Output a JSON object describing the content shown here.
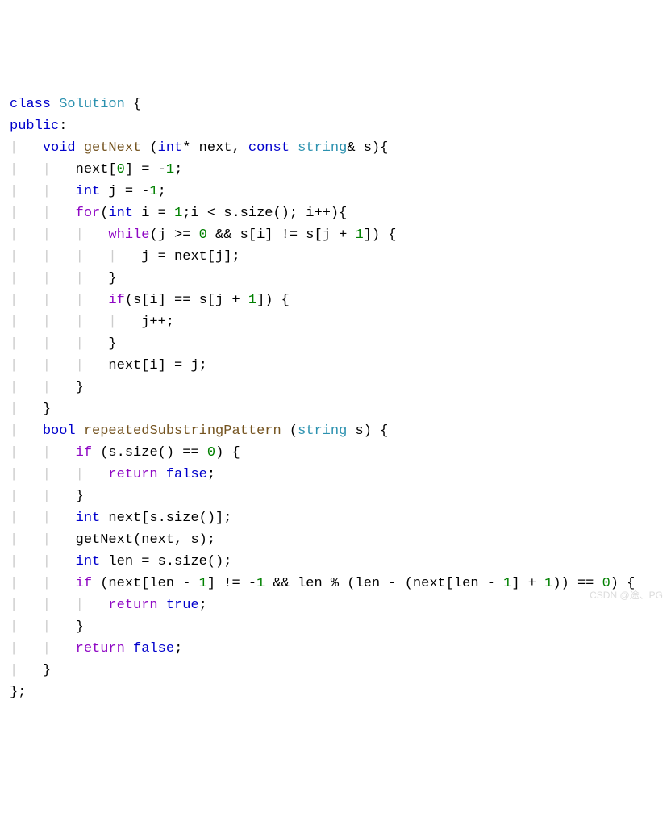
{
  "code": {
    "lines": [
      [
        {
          "cls": "kw",
          "t": "class"
        },
        {
          "cls": "txt",
          "t": " "
        },
        {
          "cls": "classname",
          "t": "Solution"
        },
        {
          "cls": "txt",
          "t": " {"
        }
      ],
      [
        {
          "cls": "kw",
          "t": "public"
        },
        {
          "cls": "txt",
          "t": ":"
        }
      ],
      [
        {
          "cls": "guide",
          "t": "|   "
        },
        {
          "cls": "kw",
          "t": "void"
        },
        {
          "cls": "txt",
          "t": " "
        },
        {
          "cls": "method",
          "t": "getNext"
        },
        {
          "cls": "txt",
          "t": " ("
        },
        {
          "cls": "kw",
          "t": "int"
        },
        {
          "cls": "txt",
          "t": "* next, "
        },
        {
          "cls": "kw",
          "t": "const"
        },
        {
          "cls": "txt",
          "t": " "
        },
        {
          "cls": "str-kw",
          "t": "string"
        },
        {
          "cls": "txt",
          "t": "& s){"
        }
      ],
      [
        {
          "cls": "guide",
          "t": "|   |   "
        },
        {
          "cls": "txt",
          "t": "next["
        },
        {
          "cls": "num",
          "t": "0"
        },
        {
          "cls": "txt",
          "t": "] = -"
        },
        {
          "cls": "num",
          "t": "1"
        },
        {
          "cls": "txt",
          "t": ";"
        }
      ],
      [
        {
          "cls": "guide",
          "t": "|   |   "
        },
        {
          "cls": "kw",
          "t": "int"
        },
        {
          "cls": "txt",
          "t": " j = -"
        },
        {
          "cls": "num",
          "t": "1"
        },
        {
          "cls": "txt",
          "t": ";"
        }
      ],
      [
        {
          "cls": "guide",
          "t": "|   |   "
        },
        {
          "cls": "ctrl",
          "t": "for"
        },
        {
          "cls": "txt",
          "t": "("
        },
        {
          "cls": "kw",
          "t": "int"
        },
        {
          "cls": "txt",
          "t": " i = "
        },
        {
          "cls": "num",
          "t": "1"
        },
        {
          "cls": "txt",
          "t": ";i < s.size(); i++){"
        }
      ],
      [
        {
          "cls": "guide",
          "t": "|   |   |   "
        },
        {
          "cls": "ctrl",
          "t": "while"
        },
        {
          "cls": "txt",
          "t": "(j >= "
        },
        {
          "cls": "num",
          "t": "0"
        },
        {
          "cls": "txt",
          "t": " && s[i] != s[j + "
        },
        {
          "cls": "num",
          "t": "1"
        },
        {
          "cls": "txt",
          "t": "]) {"
        }
      ],
      [
        {
          "cls": "guide",
          "t": "|   |   |   |   "
        },
        {
          "cls": "txt",
          "t": "j = next[j];"
        }
      ],
      [
        {
          "cls": "guide",
          "t": "|   |   |   "
        },
        {
          "cls": "txt",
          "t": "}"
        }
      ],
      [
        {
          "cls": "guide",
          "t": "|   |   |   "
        },
        {
          "cls": "ctrl",
          "t": "if"
        },
        {
          "cls": "txt",
          "t": "(s[i] == s[j + "
        },
        {
          "cls": "num",
          "t": "1"
        },
        {
          "cls": "txt",
          "t": "]) {"
        }
      ],
      [
        {
          "cls": "guide",
          "t": "|   |   |   |   "
        },
        {
          "cls": "txt",
          "t": "j++;"
        }
      ],
      [
        {
          "cls": "guide",
          "t": "|   |   |   "
        },
        {
          "cls": "txt",
          "t": "}"
        }
      ],
      [
        {
          "cls": "guide",
          "t": "|   |   |   "
        },
        {
          "cls": "txt",
          "t": "next[i] = j;"
        }
      ],
      [
        {
          "cls": "guide",
          "t": "|   |   "
        },
        {
          "cls": "txt",
          "t": "}"
        }
      ],
      [
        {
          "cls": "guide",
          "t": "|   "
        },
        {
          "cls": "txt",
          "t": "}"
        }
      ],
      [
        {
          "cls": "guide",
          "t": "|   "
        },
        {
          "cls": "kw",
          "t": "bool"
        },
        {
          "cls": "txt",
          "t": " "
        },
        {
          "cls": "method",
          "t": "repeatedSubstringPattern"
        },
        {
          "cls": "txt",
          "t": " ("
        },
        {
          "cls": "str-kw",
          "t": "string"
        },
        {
          "cls": "txt",
          "t": " s) {"
        }
      ],
      [
        {
          "cls": "guide",
          "t": "|   |   "
        },
        {
          "cls": "ctrl",
          "t": "if"
        },
        {
          "cls": "txt",
          "t": " (s.size() == "
        },
        {
          "cls": "num",
          "t": "0"
        },
        {
          "cls": "txt",
          "t": ") {"
        }
      ],
      [
        {
          "cls": "guide",
          "t": "|   |   |   "
        },
        {
          "cls": "ctrl",
          "t": "return"
        },
        {
          "cls": "txt",
          "t": " "
        },
        {
          "cls": "kw",
          "t": "false"
        },
        {
          "cls": "txt",
          "t": ";"
        }
      ],
      [
        {
          "cls": "guide",
          "t": "|   |   "
        },
        {
          "cls": "txt",
          "t": "}"
        }
      ],
      [
        {
          "cls": "guide",
          "t": "|   |   "
        },
        {
          "cls": "kw",
          "t": "int"
        },
        {
          "cls": "txt",
          "t": " next[s.size()];"
        }
      ],
      [
        {
          "cls": "guide",
          "t": "|   |   "
        },
        {
          "cls": "txt",
          "t": "getNext(next, s);"
        }
      ],
      [
        {
          "cls": "guide",
          "t": "|   |   "
        },
        {
          "cls": "kw",
          "t": "int"
        },
        {
          "cls": "txt",
          "t": " len = s.size();"
        }
      ],
      [
        {
          "cls": "guide",
          "t": "|   |   "
        },
        {
          "cls": "ctrl",
          "t": "if"
        },
        {
          "cls": "txt",
          "t": " (next[len - "
        },
        {
          "cls": "num",
          "t": "1"
        },
        {
          "cls": "txt",
          "t": "] != -"
        },
        {
          "cls": "num",
          "t": "1"
        },
        {
          "cls": "txt",
          "t": " && len % (len - (next[len - "
        },
        {
          "cls": "num",
          "t": "1"
        },
        {
          "cls": "txt",
          "t": "] + "
        },
        {
          "cls": "num",
          "t": "1"
        },
        {
          "cls": "txt",
          "t": ")) == "
        },
        {
          "cls": "num",
          "t": "0"
        },
        {
          "cls": "txt",
          "t": ") {"
        }
      ],
      [
        {
          "cls": "guide",
          "t": "|   |   |   "
        },
        {
          "cls": "ctrl",
          "t": "return"
        },
        {
          "cls": "txt",
          "t": " "
        },
        {
          "cls": "kw",
          "t": "true"
        },
        {
          "cls": "txt",
          "t": ";"
        }
      ],
      [
        {
          "cls": "guide",
          "t": "|   |   "
        },
        {
          "cls": "txt",
          "t": "}"
        }
      ],
      [
        {
          "cls": "guide",
          "t": "|   |   "
        },
        {
          "cls": "ctrl",
          "t": "return"
        },
        {
          "cls": "txt",
          "t": " "
        },
        {
          "cls": "kw",
          "t": "false"
        },
        {
          "cls": "txt",
          "t": ";"
        }
      ],
      [
        {
          "cls": "guide",
          "t": "|   "
        },
        {
          "cls": "txt",
          "t": "}"
        }
      ],
      [
        {
          "cls": "txt",
          "t": "};"
        }
      ]
    ]
  },
  "watermark": "CSDN @途、PG"
}
